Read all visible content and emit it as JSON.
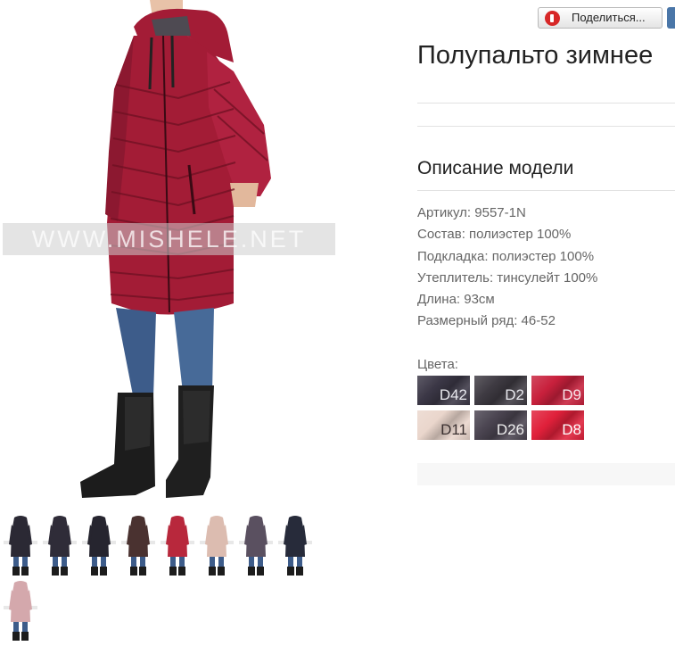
{
  "photo": {
    "watermark": "WWW.MISHELE.NET"
  },
  "share": {
    "label": "Поделиться..."
  },
  "product": {
    "title": "Полупальто зимнее",
    "description_heading": "Описание модели",
    "specs": [
      "Артикул: 9557-1N",
      "Состав: полиэстер 100%",
      "Подкладка: полиэстер 100%",
      "Утеплитель: тинсулейт 100%",
      "Длина: 93см",
      "Размерный ряд: 46-52"
    ],
    "colors_label": "Цвета:",
    "colors": [
      {
        "code": "D42",
        "color": "#3b3746",
        "text_color": "#e8e8ee"
      },
      {
        "code": "D2",
        "color": "#3e3a42",
        "text_color": "#e8e8ee"
      },
      {
        "code": "D9",
        "color": "#c8203c",
        "text_color": "#f8e6ea"
      },
      {
        "code": "D11",
        "color": "#ead6cc",
        "text_color": "#3a3030"
      },
      {
        "code": "D26",
        "color": "#4a4450",
        "text_color": "#eeeeee"
      },
      {
        "code": "D8",
        "color": "#e0203a",
        "text_color": "#ffffff"
      }
    ]
  },
  "thumbnails": [
    {
      "color": "#2b2934"
    },
    {
      "color": "#2f2c38"
    },
    {
      "color": "#26252f"
    },
    {
      "color": "#4a3230"
    },
    {
      "color": "#b8283c"
    },
    {
      "color": "#dcbcb0"
    },
    {
      "color": "#5a5060"
    },
    {
      "color": "#272b3a"
    },
    {
      "color": "#d4a8ac"
    }
  ],
  "main_colors": {
    "coat": "#a31c36",
    "coat_dark": "#7a1226",
    "jeans": "#3d5c8a",
    "boots": "#1c1c1c"
  }
}
